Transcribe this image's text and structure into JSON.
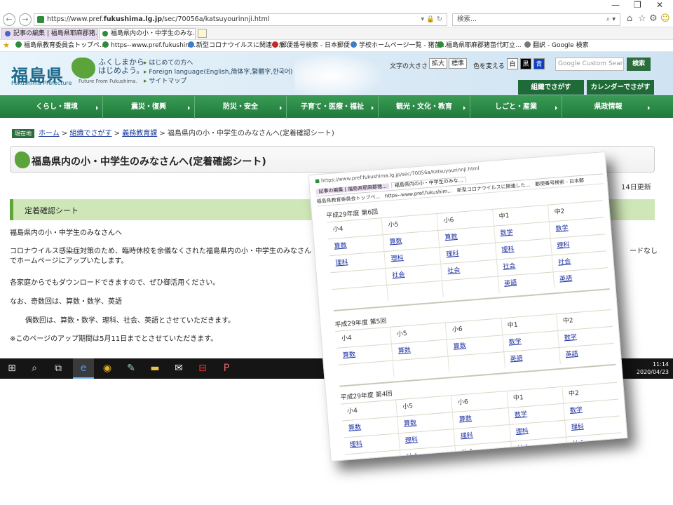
{
  "browser": {
    "url_prefix": "https://www.pref.",
    "url_domain": "fukushima.lg.jp",
    "url_path": "/sec/70056a/katsuyourinnji.html",
    "search_placeholder": "検索...",
    "tabs": [
      {
        "label": "記事の編集 | 福島県耶麻郡猪..."
      },
      {
        "label": "福島県内の小・中学生のみな..."
      }
    ],
    "favorites": [
      "福島県教育委員会トップペ...",
      "https--www.pref.fukushim...",
      "新型コロナウイルスに関連した...",
      "郵便番号検索 - 日本郵便",
      "学校ホームページ一覧 - 猪苗...",
      "福島県耶麻郡猪苗代町立...",
      "翻訳 - Google 検索"
    ]
  },
  "header": {
    "pref_name": "福島県",
    "pref_name_en": "Fukushima Prefecture",
    "tagline_1": "ふくしまから",
    "tagline_2": "はじめよう。",
    "tagline_en": "Future From Fukushima.",
    "links": [
      "はじめての方へ",
      "Foreign language(English,简体字,繁體字,한국어)",
      "サイトマップ"
    ],
    "text_size_label": "文字の大きさ",
    "enlarge": "拡大",
    "standard": "標準",
    "color_label": "色を変える",
    "color_white": "白",
    "color_black": "黒",
    "color_blue": "青",
    "search_placeholder": "Google Custom Search",
    "search_button": "検索",
    "org_button": "組織でさがす",
    "calendar_button": "カレンダーでさがす"
  },
  "nav": [
    "くらし・環境",
    "震災・復興",
    "防災・安全",
    "子育て・医療・福祉",
    "観光・文化・教育",
    "しごと・産業",
    "県政情報"
  ],
  "breadcrumb": {
    "now": "現在地",
    "home": "ホーム",
    "org": "組織でさがす",
    "edu": "義務教育課",
    "current": "福島県内の小・中学生のみなさんへ(定着確認シート)",
    "sep": " > "
  },
  "page": {
    "title": "福島県内の小・中学生のみなさんへ(定着確認シート)",
    "updated": "14日更新",
    "section": "定着確認シート",
    "paragraphs": [
      "福島県内の小・中学生のみなさんへ",
      "コロナウイルス感染症対策のため、臨時休校を余儀なくされた福島県内の小・中学生のみなさん",
      "ードなし",
      "でホームページにアップいたします。",
      "各家庭からでもダウンロードできますので、ぜひ御活用ください。",
      "なお、奇数回は、算数・数学、英語",
      "偶数回は、算数・数学、理科、社会、英語とさせていただきます。",
      "※このページのアップ期間は5月11日までとさせていただきます。"
    ]
  },
  "taskbar": {
    "time": "11:14",
    "date": "2020/04/23"
  },
  "overlay": {
    "url": "https://www.pref.fukushima.lg.jp/sec/70056a/katsuyourinnji.html",
    "tabs": [
      "記事の編集 | 福島県耶麻郡猪...",
      "福島県内の小・中学生のみな..."
    ],
    "favs": [
      "福島県教育委員会トップペ...",
      "https--www.pref.fukushim...",
      "新型コロナウイルスに関連した...",
      "郵便番号検索 - 日本郵"
    ],
    "tables": [
      {
        "caption": "平成29年度 第6回",
        "headers": [
          "小4",
          "小5",
          "小6",
          "中1",
          "中2"
        ],
        "rows": [
          [
            "算数",
            "算数",
            "算数",
            "数学",
            "数学"
          ],
          [
            "理科",
            "理科",
            "理科",
            "理科",
            "理科"
          ],
          [
            "",
            "社会",
            "社会",
            "社会",
            "社会"
          ],
          [
            "",
            "",
            "",
            "英語",
            "英語"
          ]
        ]
      },
      {
        "caption": "平成29年度 第5回",
        "headers": [
          "小4",
          "小5",
          "小6",
          "中1",
          "中2"
        ],
        "rows": [
          [
            "算数",
            "算数",
            "算数",
            "数学",
            "数学"
          ],
          [
            "",
            "",
            "",
            "英語",
            "英語"
          ]
        ]
      },
      {
        "caption": "平成29年度 第4回",
        "headers": [
          "小4",
          "小5",
          "小6",
          "中1",
          "中2"
        ],
        "rows": [
          [
            "算数",
            "算数",
            "算数",
            "数学",
            "数学"
          ],
          [
            "理科",
            "理科",
            "理科",
            "理科",
            "理科"
          ],
          [
            "",
            "社会",
            "社会",
            "社会",
            "社会"
          ]
        ]
      }
    ]
  }
}
